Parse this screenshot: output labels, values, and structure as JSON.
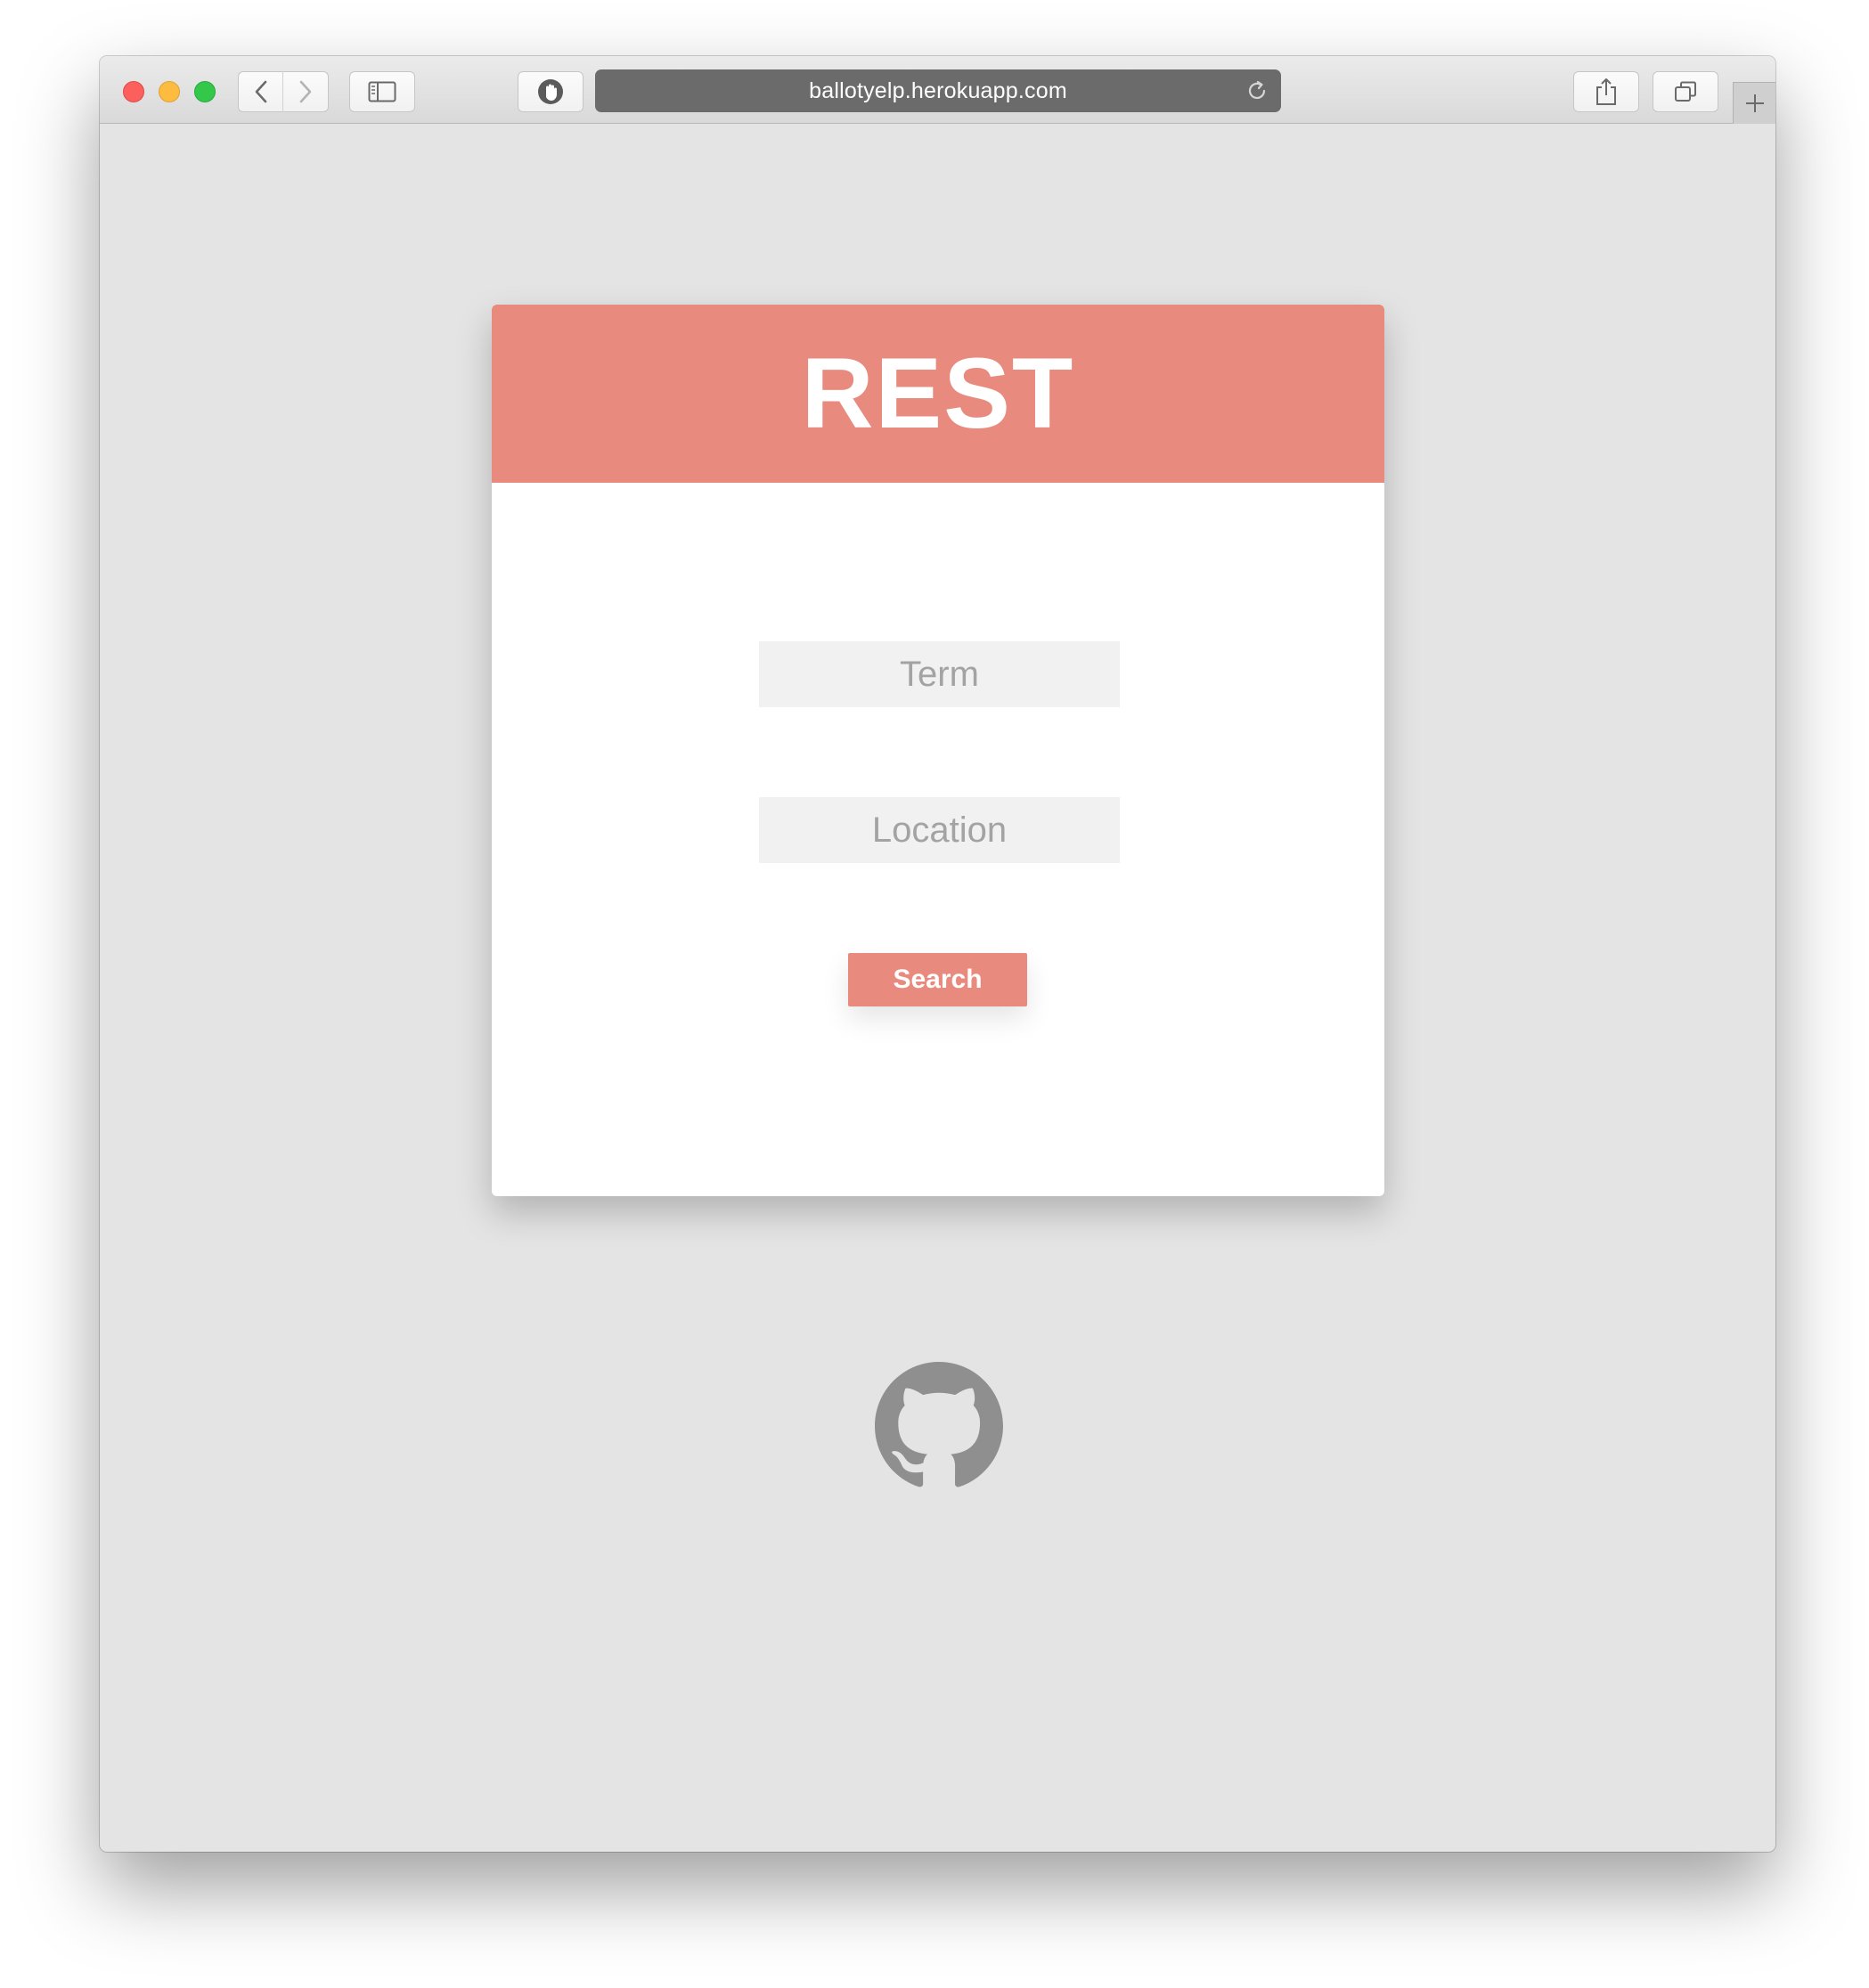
{
  "browser": {
    "url": "ballotyelp.herokuapp.com",
    "icons": {
      "close": "close-light",
      "minimize": "minimize-light",
      "zoom": "zoom-light",
      "back": "chevron-left-icon",
      "forward": "chevron-right-icon",
      "sidebar": "sidebar-icon",
      "privacy": "shield-hand-icon",
      "reload": "reload-icon",
      "share": "share-icon",
      "tabs": "tabs-overview-icon",
      "new_tab": "plus-icon"
    }
  },
  "app": {
    "title": "REST",
    "term_placeholder": "Term",
    "location_placeholder": "Location",
    "search_label": "Search",
    "footer_icon": "github-icon"
  },
  "colors": {
    "accent": "#e88b7e",
    "page_background": "#e4e4e4",
    "field_background": "#f1f1f1",
    "icon_gray": "#8f8f8f"
  }
}
